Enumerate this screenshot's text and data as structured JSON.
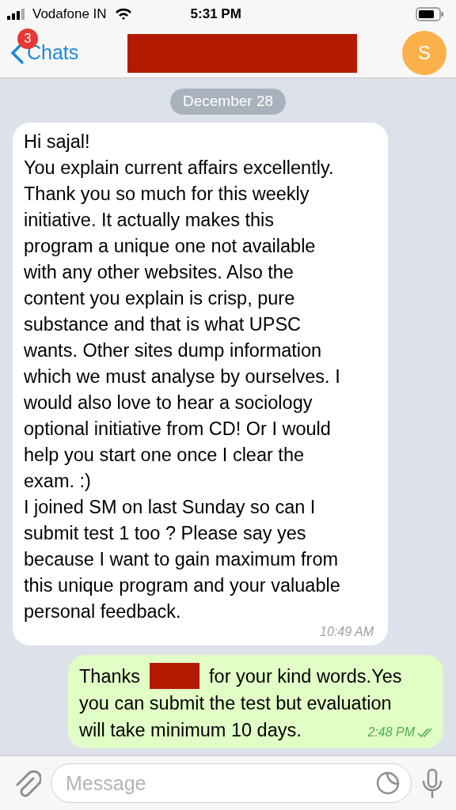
{
  "status_bar": {
    "carrier": "Vodafone IN",
    "time": "5:31 PM"
  },
  "nav": {
    "back_label": "Chats",
    "unread_badge": "3",
    "avatar_letter": "S"
  },
  "date_pill": "December 28",
  "messages": [
    {
      "kind": "incoming",
      "text": "Hi sajal!\nYou explain current affairs excellently.\nThank you so much for this weekly\ninitiative. It actually makes this\nprogram a unique one not available\nwith any other websites. Also the\ncontent you explain is crisp, pure\nsubstance and that is what UPSC\nwants. Other sites dump information\nwhich we must analyse by ourselves. I\nwould also love to hear a sociology\noptional initiative from CD! Or I would\nhelp you start one once I clear the\nexam. :)\nI joined SM on last Sunday so can I\nsubmit test 1 too ? Please say yes\nbecause I want to gain maximum from\nthis unique program and your valuable\npersonal feedback.",
      "time": "10:49 AM"
    },
    {
      "kind": "outgoing",
      "text_before": "Thanks",
      "lines": [
        "for your kind words.Yes",
        "you can submit the test but evaluation",
        "will take minimum 10 days."
      ],
      "time": "2:48 PM",
      "read": true
    }
  ],
  "composer": {
    "placeholder": "Message"
  }
}
